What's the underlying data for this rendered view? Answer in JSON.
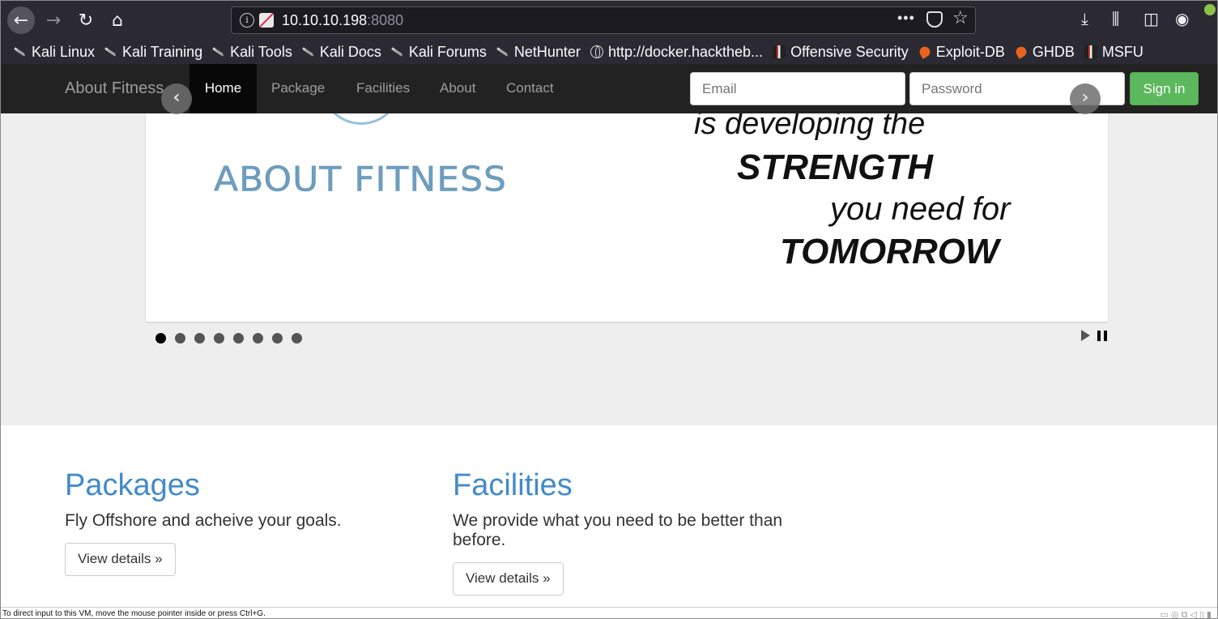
{
  "browser": {
    "url_host": "10.10.10.198",
    "url_port": ":8080",
    "bookmarks": [
      {
        "label": "Kali Linux",
        "icon": "kali-dragon-icon"
      },
      {
        "label": "Kali Training",
        "icon": "kali-dragon-icon"
      },
      {
        "label": "Kali Tools",
        "icon": "kali-dragon-icon"
      },
      {
        "label": "Kali Docs",
        "icon": "kali-dragon-icon"
      },
      {
        "label": "Kali Forums",
        "icon": "kali-dragon-icon"
      },
      {
        "label": "NetHunter",
        "icon": "nethunter-icon"
      },
      {
        "label": "http://docker.hacktheb...",
        "icon": "globe-icon"
      },
      {
        "label": "Offensive Security",
        "icon": "offsec-icon"
      },
      {
        "label": "Exploit-DB",
        "icon": "exploitdb-icon"
      },
      {
        "label": "GHDB",
        "icon": "exploitdb-icon"
      },
      {
        "label": "MSFU",
        "icon": "offsec-icon"
      }
    ]
  },
  "site": {
    "brand": "About Fitness",
    "nav": {
      "home": "Home",
      "package": "Package",
      "facilities": "Facilities",
      "about": "About",
      "contact": "Contact"
    },
    "login": {
      "email_placeholder": "Email",
      "password_placeholder": "Password",
      "signin_label": "Sign in"
    }
  },
  "carousel": {
    "logo_text": "ABOUT FITNESS",
    "quote_line1": "is developing the",
    "quote_line2": "STRENGTH",
    "quote_line3": "you need for",
    "quote_line4": "TOMORROW",
    "slide_count": 8,
    "active_slide": 1
  },
  "columns": [
    {
      "heading": "Packages",
      "text": "Fly Offshore and acheive your goals.",
      "button": "View details »"
    },
    {
      "heading": "Facilities",
      "text": "We provide what you need to be better than before.",
      "button": "View details »"
    }
  ],
  "statusbar": {
    "text": "To direct input to this VM, move the mouse pointer inside or press Ctrl+G."
  }
}
